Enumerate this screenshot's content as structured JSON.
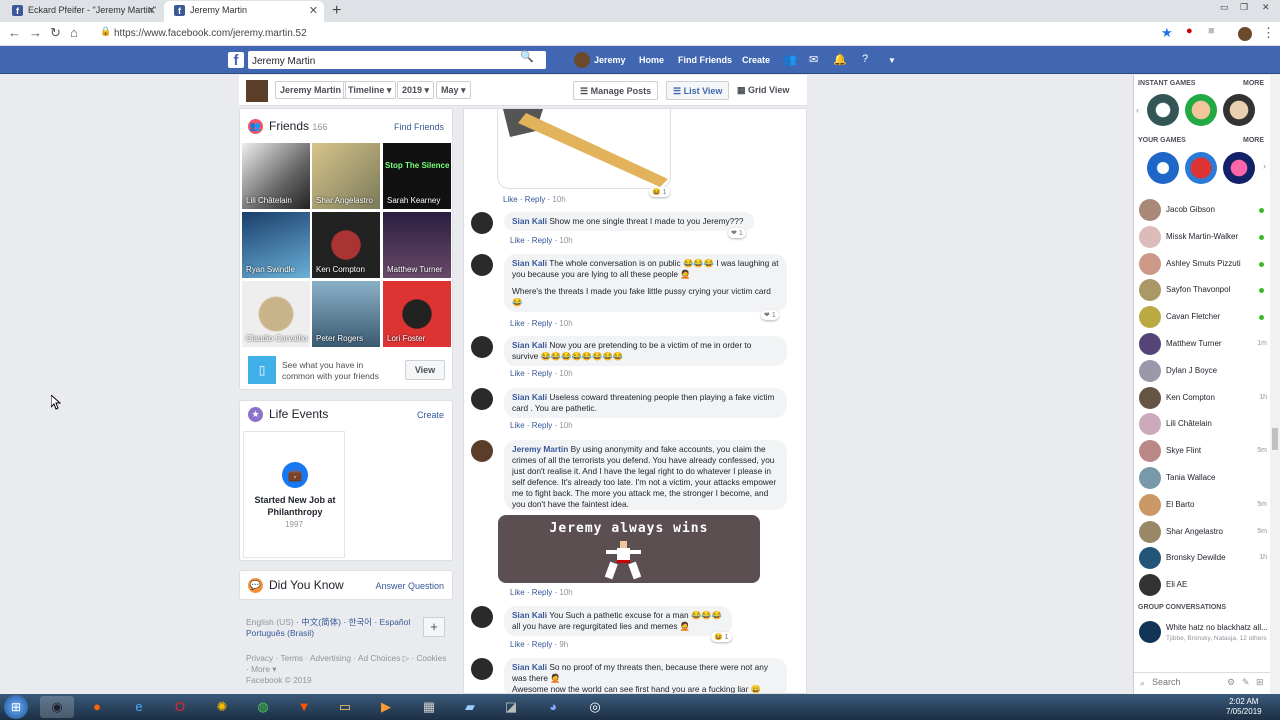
{
  "browser": {
    "tabs": [
      {
        "title": "Eckard Pfeifer - \"Jeremy Martin\""
      },
      {
        "title": "Jeremy Martin"
      }
    ],
    "url": "https://www.facebook.com/jeremy.martin.52"
  },
  "header": {
    "search_value": "Jeremy Martin",
    "user_name": "Jeremy",
    "nav": [
      "Home",
      "Find Friends",
      "Create"
    ]
  },
  "timeline_bar": {
    "profile_name": "Jeremy Martin",
    "crumbs": [
      "Timeline",
      "2019",
      "May"
    ],
    "manage_posts": "Manage Posts",
    "list_view": "List View",
    "grid_view": "Grid View"
  },
  "friends": {
    "title": "Friends",
    "count": "166",
    "find_link": "Find Friends",
    "list": [
      {
        "name": "Lili Châtelain"
      },
      {
        "name": "Shar Angelastro"
      },
      {
        "name": "Sarah Kearney",
        "overlay": "Stop The Silence"
      },
      {
        "name": "Ryan Swindle"
      },
      {
        "name": "Ken Compton"
      },
      {
        "name": "Matthew Turner"
      },
      {
        "name": "Claudio Carvalho"
      },
      {
        "name": "Peter Rogers"
      },
      {
        "name": "Lori Foster"
      }
    ],
    "common_text": "See what you have in common with your friends",
    "view_button": "View"
  },
  "life_events": {
    "title": "Life Events",
    "create_link": "Create",
    "event_title": "Started New Job at Philanthropy",
    "event_year": "1997"
  },
  "did_you_know": {
    "title": "Did You Know",
    "answer_link": "Answer Question"
  },
  "languages": [
    "English (US)",
    "中文(简体)",
    "한국어",
    "Español",
    "Português (Brasil)"
  ],
  "footer_links": [
    "Privacy",
    "Terms",
    "Advertising",
    "Ad Choices",
    "Cookies",
    "More"
  ],
  "copyright": "Facebook © 2019",
  "feed": {
    "like": "Like",
    "reply": "Reply",
    "image_text": "Jeremy always wins",
    "comments": [
      {
        "author": "",
        "text": "",
        "time": "10h",
        "reaction": "1"
      },
      {
        "author": "Sian Kali",
        "text": "Show me one single threat I made to you Jeremy???",
        "time": "10h",
        "reaction": "1"
      },
      {
        "author": "Sian Kali",
        "text": "The whole conversation is on public 😂😂😂 I was laughing at you because you are lying to all these people 🤦",
        "text2": "Where's the threats I made you fake little pussy crying your victim card 😂",
        "time": "10h",
        "reaction": "1"
      },
      {
        "author": "Sian Kali",
        "text": "Now you are pretending to be a victim of me in order to survive 😂😂😂😂😂😂😂😂",
        "time": "10h"
      },
      {
        "author": "Sian Kali",
        "text": "Useless coward threatening people then playing a fake victim card . You are pathetic.",
        "time": "10h"
      },
      {
        "author": "Jeremy Martin",
        "text": "By using anonymity and fake accounts, you claim the crimes of all the terrorists you defend. You have already confessed, you just don't realise it. And I have the legal right to do whatever I please in self defence. It's already too late. I'm not a victim, your attacks empower me to fight back. The more you attack me, the stronger I become, and you don't have the faintest idea.",
        "time": "10h"
      },
      {
        "author": "Sian Kali",
        "text": "You Such a pathetic excuse for a man 😂😂😂 all you have are regurgitated lies and memes 🤦",
        "time": "9h",
        "reaction": "1"
      },
      {
        "author": "Sian Kali",
        "text": "So no proof of my threats then, because there were not any was there 🤦",
        "text2": "Awesome now the world can see first hand you are a fucking liar 😀"
      }
    ]
  },
  "sidebar": {
    "instant_games": "INSTANT GAMES",
    "your_games": "YOUR GAMES",
    "more": "MORE",
    "contacts": [
      {
        "name": "Jacob Gibson",
        "online": true
      },
      {
        "name": "Missk Martin-Walker",
        "online": true
      },
      {
        "name": "Ashley Smuts Pizzuti",
        "online": true
      },
      {
        "name": "Sayfon Thavonpol",
        "online": true
      },
      {
        "name": "Cavan Fletcher",
        "online": true
      },
      {
        "name": "Matthew Turner",
        "time": "1m"
      },
      {
        "name": "Dylan J Boyce",
        "time": ""
      },
      {
        "name": "Ken Compton",
        "time": "1h"
      },
      {
        "name": "Lili Châtelain",
        "time": ""
      },
      {
        "name": "Skye Flint",
        "time": "5m"
      },
      {
        "name": "Tania Wallace",
        "time": ""
      },
      {
        "name": "El Barto",
        "time": "5m"
      },
      {
        "name": "Shar Angelastro",
        "time": "5m"
      },
      {
        "name": "Bronsky Dewilde",
        "time": "1h"
      },
      {
        "name": "Eli AE",
        "time": ""
      }
    ],
    "group_heading": "GROUP CONVERSATIONS",
    "group_name": "White hatz no blackhatz all...",
    "group_members": "Tjibbe, Bronsky, Natasja, 12 others",
    "search_placeholder": "Search"
  },
  "taskbar": {
    "time": "2:02 AM",
    "date": "7/05/2019"
  }
}
